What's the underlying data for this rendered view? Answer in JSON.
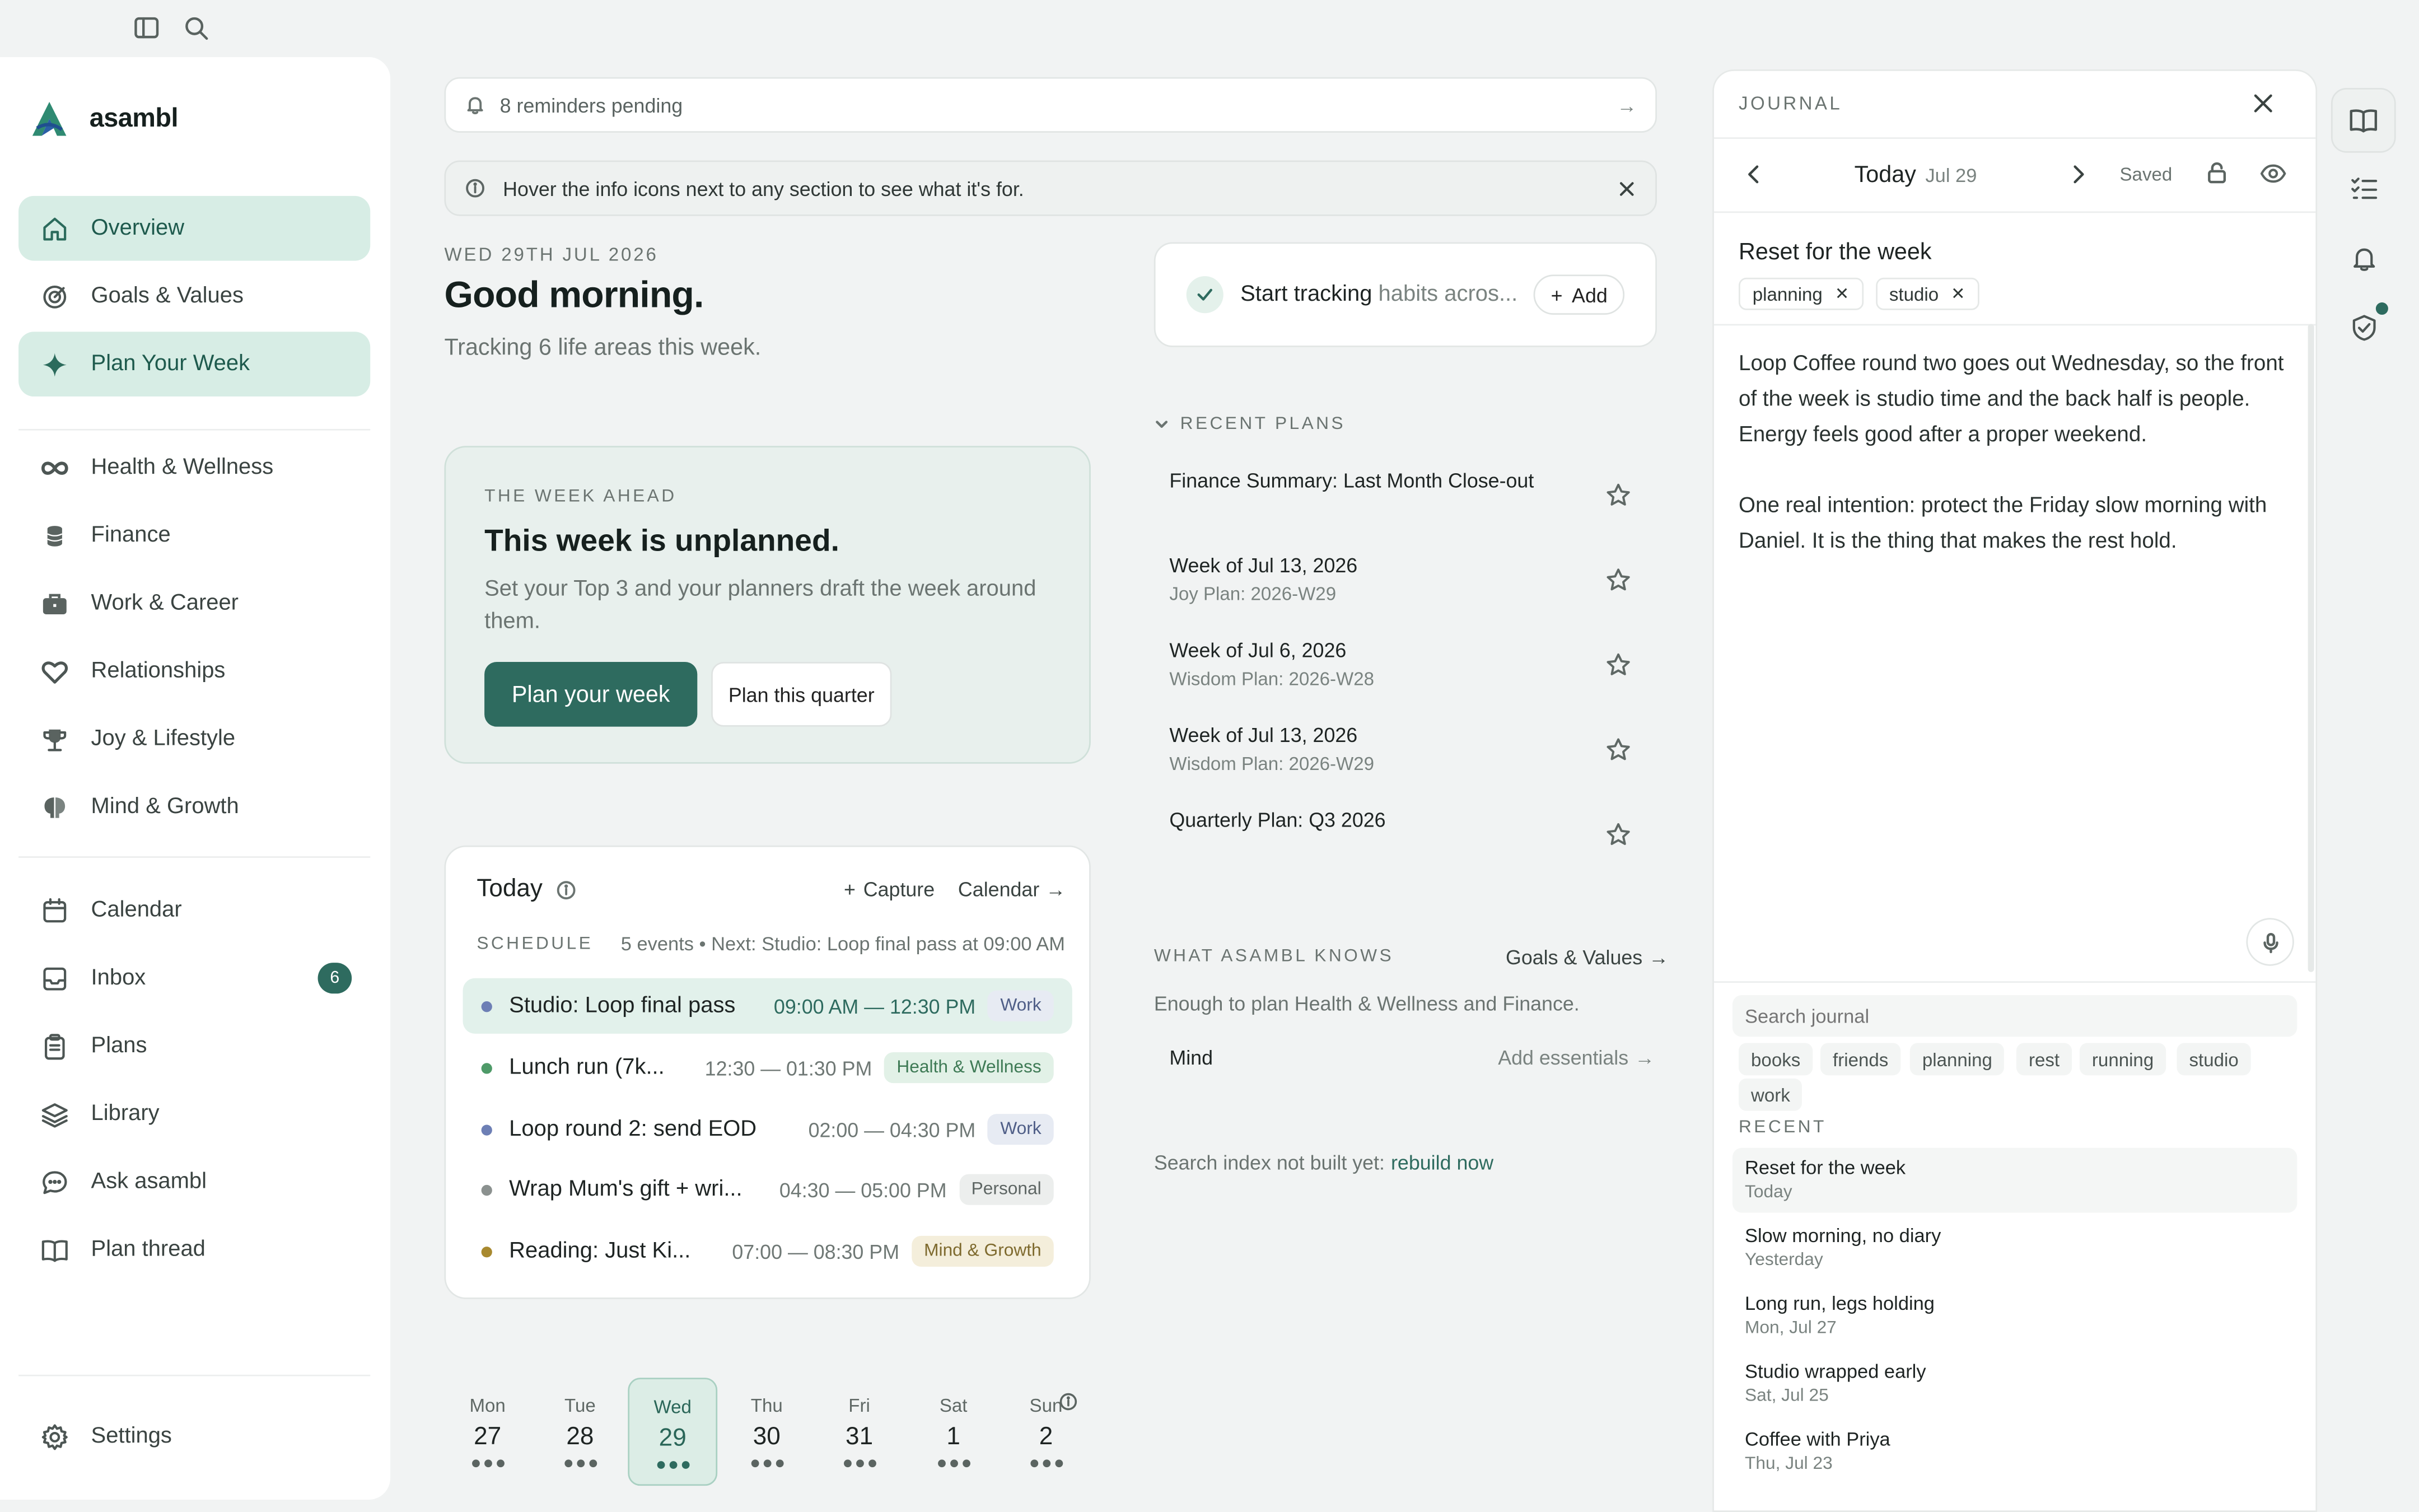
{
  "topbar": {
    "icons": [
      "sidebar-toggle-icon",
      "search-icon"
    ]
  },
  "brand": {
    "name": "asambl"
  },
  "sidebar": {
    "primary": [
      {
        "label": "Overview",
        "icon": "home-icon",
        "active": true
      },
      {
        "label": "Goals & Values",
        "icon": "target-icon",
        "active": false
      },
      {
        "label": "Plan Your Week",
        "icon": "sparkle-icon",
        "active": true
      }
    ],
    "areas": [
      {
        "label": "Health & Wellness",
        "icon": "infinity-icon"
      },
      {
        "label": "Finance",
        "icon": "coins-icon"
      },
      {
        "label": "Work & Career",
        "icon": "briefcase-icon"
      },
      {
        "label": "Relationships",
        "icon": "heart-icon"
      },
      {
        "label": "Joy & Lifestyle",
        "icon": "trophy-icon"
      },
      {
        "label": "Mind & Growth",
        "icon": "brain-icon"
      }
    ],
    "tools": [
      {
        "label": "Calendar",
        "icon": "calendar-icon"
      },
      {
        "label": "Inbox",
        "icon": "inbox-icon",
        "badge": "6"
      },
      {
        "label": "Plans",
        "icon": "clipboard-icon"
      },
      {
        "label": "Library",
        "icon": "layers-icon"
      },
      {
        "label": "Ask asambl",
        "icon": "chat-icon"
      },
      {
        "label": "Plan thread",
        "icon": "book-icon"
      }
    ],
    "settings": {
      "label": "Settings",
      "icon": "gear-icon"
    }
  },
  "reminders": {
    "text": "8 reminders pending"
  },
  "info_banner": {
    "text": "Hover the info icons next to any section to see what it's for."
  },
  "greeting": {
    "date": "WED 29TH JUL 2026",
    "title": "Good morning.",
    "subtitle": "Tracking 6 life areas this week."
  },
  "habits": {
    "lead": "Start tracking",
    "rest": "habits acros...",
    "add_label": "Add"
  },
  "week_ahead": {
    "eyebrow": "THE WEEK AHEAD",
    "title": "This week is unplanned.",
    "body": "Set your Top 3 and your planners draft the week around them.",
    "primary_btn": "Plan your week",
    "secondary_btn": "Plan this quarter"
  },
  "today": {
    "title": "Today",
    "capture_label": "Capture",
    "calendar_label": "Calendar",
    "schedule_label": "SCHEDULE",
    "schedule_summary": "5 events • Next: Studio: Loop final pass at 09:00 AM",
    "events": [
      {
        "title": "Studio: Loop final pass",
        "time": "09:00 AM — 12:30 PM",
        "tag": "Work",
        "color": "#6d7fb5",
        "tag_bg": "#e7ebf3",
        "tag_fg": "#4f5e87",
        "highlight": true
      },
      {
        "title": "Lunch run (7k...",
        "time": "12:30 — 01:30 PM",
        "tag": "Health & Wellness",
        "color": "#4e9a68",
        "tag_bg": "#e2f1e7",
        "tag_fg": "#3e7a55",
        "highlight": false
      },
      {
        "title": "Loop round 2: send EOD",
        "time": "02:00 — 04:30 PM",
        "tag": "Work",
        "color": "#6d7fb5",
        "tag_bg": "#e7ebf3",
        "tag_fg": "#4f5e87",
        "highlight": false
      },
      {
        "title": "Wrap Mum's gift + wri...",
        "time": "04:30 — 05:00 PM",
        "tag": "Personal",
        "color": "#8b918f",
        "tag_bg": "#eceeed",
        "tag_fg": "#5e6664",
        "highlight": false
      },
      {
        "title": "Reading: Just Ki...",
        "time": "07:00 — 08:30 PM",
        "tag": "Mind & Growth",
        "color": "#a8892f",
        "tag_bg": "#f4eedb",
        "tag_fg": "#7e6a2e",
        "highlight": false
      }
    ]
  },
  "week_strip": [
    {
      "name": "Mon",
      "date": "27",
      "selected": false
    },
    {
      "name": "Tue",
      "date": "28",
      "selected": false
    },
    {
      "name": "Wed",
      "date": "29",
      "selected": true
    },
    {
      "name": "Thu",
      "date": "30",
      "selected": false
    },
    {
      "name": "Fri",
      "date": "31",
      "selected": false
    },
    {
      "name": "Sat",
      "date": "1",
      "selected": false
    },
    {
      "name": "Sun",
      "date": "2",
      "selected": false
    }
  ],
  "recent_plans": {
    "label": "RECENT PLANS",
    "items": [
      {
        "title": "Finance Summary: Last Month Close-out",
        "sub": ""
      },
      {
        "title": "Week of Jul 13, 2026",
        "sub": "Joy Plan: 2026-W29"
      },
      {
        "title": "Week of Jul 6, 2026",
        "sub": "Wisdom Plan: 2026-W28"
      },
      {
        "title": "Week of Jul 13, 2026",
        "sub": "Wisdom Plan: 2026-W29"
      },
      {
        "title": "Quarterly Plan: Q3 2026",
        "sub": ""
      }
    ]
  },
  "knows": {
    "label": "WHAT ASAMBL KNOWS",
    "link": "Goals & Values",
    "summary": "Enough to plan Health & Wellness and Finance.",
    "row_label": "Mind",
    "row_action": "Add essentials",
    "index_text": "Search index not built yet:",
    "index_link": "rebuild now"
  },
  "journal": {
    "label": "JOURNAL",
    "day": "Today",
    "date": "Jul 29",
    "status": "Saved",
    "entry_title": "Reset for the week",
    "chips": [
      "planning",
      "studio"
    ],
    "body_p1": "Loop Coffee round two goes out Wednesday, so the front of the week is studio time and the back half is people. Energy feels good after a proper weekend.",
    "body_p2": "One real intention: protect the Friday slow morning with Daniel. It is the thing that makes the rest hold.",
    "search_placeholder": "Search journal",
    "tags": [
      "books",
      "friends",
      "planning",
      "rest",
      "running",
      "studio",
      "work"
    ],
    "recent_label": "RECENT",
    "recent": [
      {
        "title": "Reset for the week",
        "date": "Today",
        "active": true
      },
      {
        "title": "Slow morning, no diary",
        "date": "Yesterday",
        "active": false
      },
      {
        "title": "Long run, legs holding",
        "date": "Mon, Jul 27",
        "active": false
      },
      {
        "title": "Studio wrapped early",
        "date": "Sat, Jul 25",
        "active": false
      },
      {
        "title": "Coffee with Priya",
        "date": "Thu, Jul 23",
        "active": false
      }
    ]
  },
  "rail": {
    "icons": [
      "book-open-icon",
      "checklist-icon",
      "bell-icon",
      "shield-check-icon"
    ]
  },
  "colors": {
    "accent": "#2e6b5f",
    "accent_soft": "#d7ede5",
    "background": "#f1f3f3"
  }
}
